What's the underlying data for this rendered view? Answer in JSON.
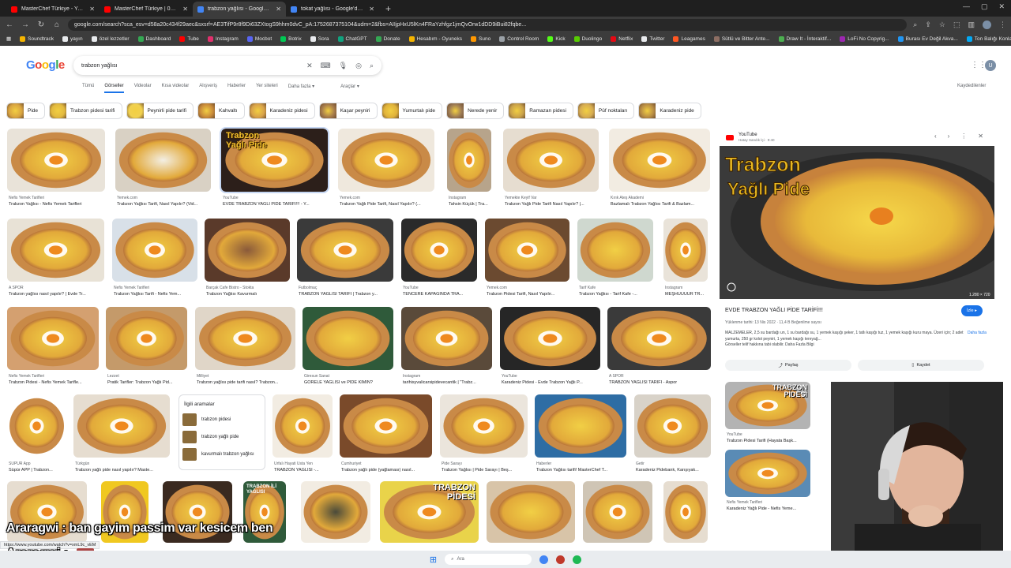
{
  "browser": {
    "tabs": [
      {
        "title": "MasterChef Türkiye - YouTube",
        "color": "#ff0000"
      },
      {
        "title": "MasterChef Türkiye | 02.07.2025",
        "color": "#ff0000"
      },
      {
        "title": "trabzon yağlısı - Google'da Ara",
        "color": "#4285f4",
        "active": true
      },
      {
        "title": "tokat yağlısı - Google'da Ara",
        "color": "#4285f4"
      }
    ],
    "url": "google.com/search?sca_esv=d58a20c434f29aec&sxsrf=AE3TifP9r8f9Di63ZXtogS9hhm0dvC_pA:1752687375104&udm=2&fbs=AIIjpHxU5lKn4FRaYzhfgz1jmQvOrw1dDD9iBui82fqbe...",
    "bookmarks": [
      "Soundtrack",
      "yayın",
      "özel lezzetler",
      "Dashboard",
      "Tube",
      "Instagram",
      "Mocbot",
      "Botrix",
      "Sora",
      "ChatGPT",
      "Donate",
      "Hesabım - Oyuneks",
      "Suno",
      "Control Room",
      "Kick",
      "Duolingo",
      "Netflix",
      "Twitter",
      "Leagames",
      "Sütlü ve Bitter Ante...",
      "Draw It - İnteraktif...",
      "LoFi No Copyrig...",
      "Burası Ev Değil Akva...",
      "Ton Balığı Konlama..."
    ]
  },
  "google": {
    "logo": [
      "G",
      "o",
      "o",
      "g",
      "l",
      "e"
    ],
    "query": "trabzon yağlısı",
    "filters": [
      "Tümü",
      "Görseller",
      "Videolar",
      "Kısa videolar",
      "Alışveriş",
      "Haberler",
      "Yer siteleri",
      "Daha fazla ▾",
      "Araçlar ▾"
    ],
    "saved": "Kaydedilenler",
    "account_initial": "U"
  },
  "chips": [
    "Pide",
    "Trabzon pidesi tarifi",
    "Peynirli pide tarifi",
    "Kahvaltı",
    "Karadeniz pidesi",
    "Kaşar peyniri",
    "Yumurtalı pide",
    "Nerede yenir",
    "Ramazan pidesi",
    "Püf noktaları",
    "Karadeniz pide"
  ],
  "results": [
    {
      "src": "Nefis Yemek Tarifleri",
      "cap": "Trabzon Yağlısı - Nefis Yemek Tarifleri"
    },
    {
      "src": "Yemek.com",
      "cap": "Trabzon Yağlısı Tarifi, Nasıl Yapılır? (Vid..."
    },
    {
      "src": "YouTube",
      "cap": "EVDE TRABZON YAĞLI PİDE TARİFİ!!! - Y...",
      "overlay": "Trabzon Yağlı Pide"
    },
    {
      "src": "Yemek.com",
      "cap": "Trabzon Yağlı Pide Tarifi, Nasıl Yapılır? (..."
    },
    {
      "src": "Instagram",
      "cap": "Tahsin Küçük | Tra..."
    },
    {
      "src": "Yemekte Keyif Var",
      "cap": "Trabzon Yağlı Pide Tarifi Nasıl Yapılır? |..."
    },
    {
      "src": "Kırık Ateş Akademi",
      "cap": "Bazlamalı Trabzon Yağlısı Tarifi & Bazlam..."
    },
    {
      "src": "A SPOR",
      "cap": "Trabzon yağlısı nasıl yapılır? | Evde Tr..."
    },
    {
      "src": "Nefis Yemek Tarifleri",
      "cap": "Trabzon Yağlısı Tarifi - Nefis Yem..."
    },
    {
      "src": "Barçak Cafe Bistro - Stokta",
      "cap": "Trabzon Yağlısı Kavurmalı"
    },
    {
      "src": "Futbolmaç",
      "cap": "TRABZON YAĞLISI TARİFİ | Trabzon y..."
    },
    {
      "src": "YouTube",
      "cap": "TENCERE KAPAĞINDA TRA..."
    },
    {
      "src": "Yemek.com",
      "cap": "Trabzon Pidesi Tarifi, Nasıl Yapılır..."
    },
    {
      "src": "Tarif Kafe",
      "cap": "Trabzon Yağlısı - Tarif Kafe -..."
    },
    {
      "src": "Instagram",
      "cap": "MEŞHUUUUR TR..."
    },
    {
      "src": "Nefis Yemek Tarifleri",
      "cap": "Trabzon Pidesi - Nefis Yemek Tarifle..."
    },
    {
      "src": "Lezzet",
      "cap": "Pratik Tarifler: Trabzon Yağlı Pid..."
    },
    {
      "src": "Milliyet",
      "cap": "Trabzon yağlısı pide tarifi nasıl? Trabzon..."
    },
    {
      "src": "Giresun Sanat",
      "cap": "GÖRELE YAĞLISI ve PİDE KİMİN?"
    },
    {
      "src": "Instagram",
      "cap": "tarihisyvalicarsipidevecantik | \"Trabz..."
    },
    {
      "src": "YouTube",
      "cap": "Karadeniz Pidesi - Evde Trabzon Yağlı P..."
    },
    {
      "src": "A SPOR",
      "cap": "TRABZON YAĞLISI TARİFİ - Aspor"
    },
    {
      "src": "SÜPÜR App",
      "cap": "Süpür APP | Trabzon..."
    },
    {
      "src": "Türkgün",
      "cap": "Trabzon yağlı pide nasıl yapılır? Maste..."
    },
    {
      "src": "Urfalı Hayati Usta Yen",
      "cap": "TRABZON YAĞLISI -..."
    },
    {
      "src": "Cumhuriyet",
      "cap": "Trabzon yağlı pide (yağlaması) nasıl..."
    },
    {
      "src": "Pide Sarayı",
      "cap": "Trabzon Yağlısı | Pide Sarayı | Beş..."
    },
    {
      "src": "Haberler",
      "cap": "Trabzon Yağlısı tarifi! MasterChef T..."
    },
    {
      "src": "Getir",
      "cap": "Karadeniz Pidebank, Karışıyak..."
    }
  ],
  "related": {
    "title": "İlgili aramalar",
    "items": [
      "trabzon pidesi",
      "trabzon yağlı pide",
      "kavurmalı trabzon yağlısı"
    ]
  },
  "row5_overlays": [
    "TRABZON İLİ YAĞLISI",
    "TRABZON PİDESİ"
  ],
  "panel": {
    "source": "YouTube",
    "channel": "Hatay Sandık İçi · 9:40",
    "overlay_line1": "Trabzon",
    "overlay_line2": "Yağlı Pide",
    "size": "1.280 × 720",
    "title": "EVDE TRABZON YAĞLI PİDE TARİFİ!!!",
    "follow": "İzle ▸",
    "meta": "Yüklenme tarihi: 13 Nis 2022 · 11,4 B Beğenilme sayısı",
    "desc": "MALZEMELER, 2,5 su bardağı un, 1 su bardağı su, 1 yemek kaşığı şeker, 1 tatlı kaşığı tuz, 1 yemek kaşığı kuru maya. Üzeri için; 2 adet yumurta, 250 gr kolot peyniri, 1 yemek kaşığı tereyağ...",
    "desc2": "Görseller telif hakkına tabi olabilir. Daha Fazla Bilgi",
    "more": "Daha fazla",
    "share": "Paylaş",
    "save": "Kaydet"
  },
  "related_panel": [
    {
      "src": "YouTube",
      "cap": "Trabzon Pidesi Tarifi (Hayata Başk...",
      "overlay": "TRABZON PİDESİ"
    },
    {
      "src": "Nefis Yemek Tarifleri",
      "cap": "Karadeniz Yağlı Pide - Nefis Yeme..."
    }
  ],
  "chat": {
    "line1": "Araragwi : ban gayim passim var kesicem ben",
    "line2": "Araragwi :"
  },
  "status_url": "https://www.youtube.com/watch?v=xmL9c_vEM",
  "taskbar": {
    "search": "Ara"
  }
}
